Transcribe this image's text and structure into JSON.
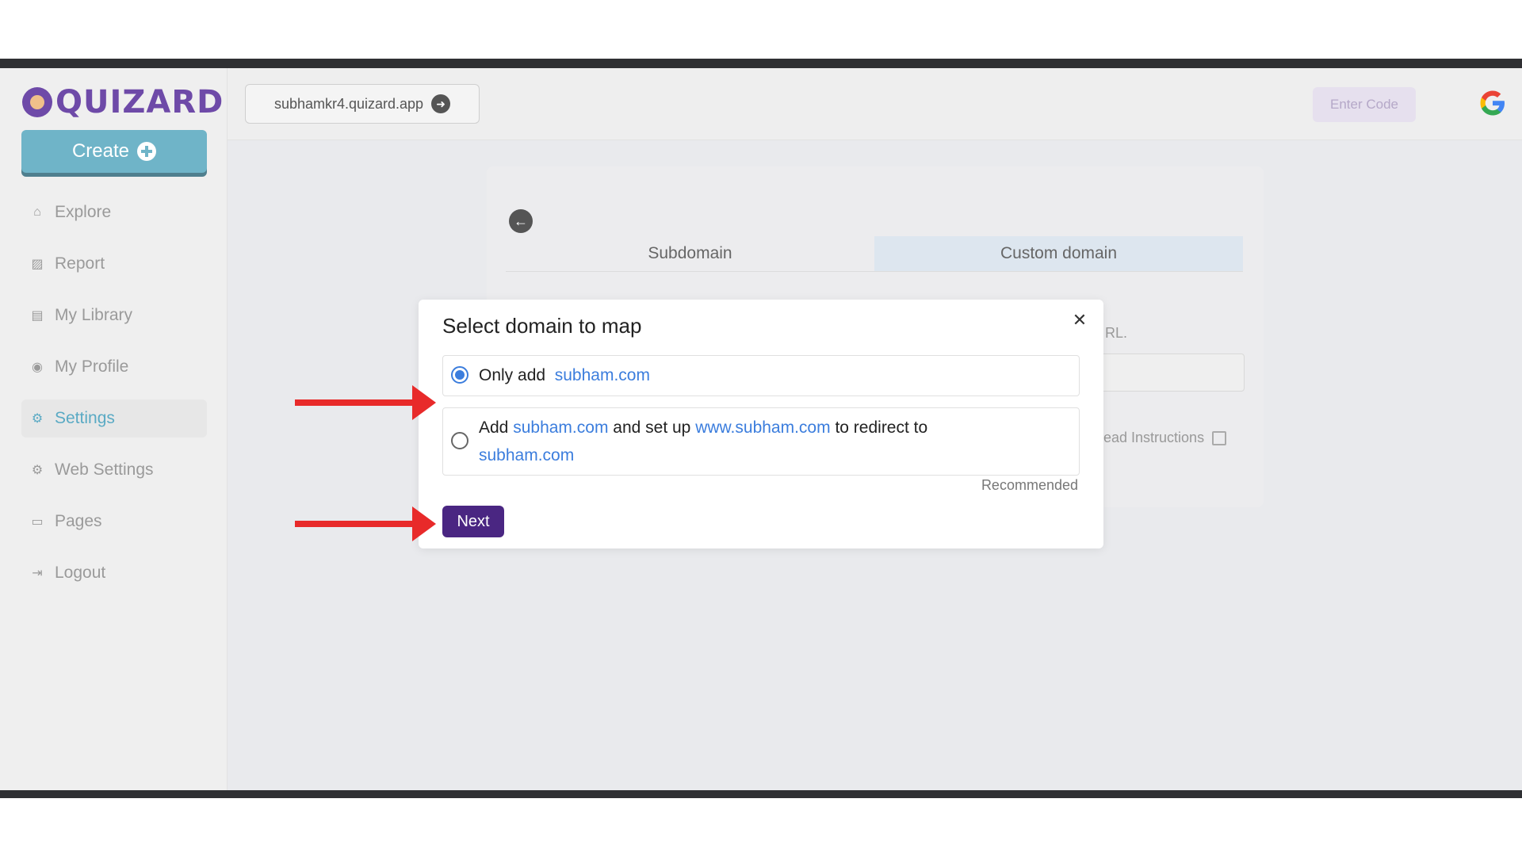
{
  "sidebar": {
    "logo": "QUIZARD",
    "create_label": "Create",
    "items": [
      {
        "label": "Explore",
        "icon": "home-icon"
      },
      {
        "label": "Report",
        "icon": "chart-icon"
      },
      {
        "label": "My Library",
        "icon": "library-icon"
      },
      {
        "label": "My Profile",
        "icon": "profile-icon"
      },
      {
        "label": "Settings",
        "icon": "gear-icon",
        "active": true
      },
      {
        "label": "Web Settings",
        "icon": "gear-icon"
      },
      {
        "label": "Pages",
        "icon": "pages-icon"
      },
      {
        "label": "Logout",
        "icon": "logout-icon"
      }
    ]
  },
  "header": {
    "url": "subhamkr4.quizard.app",
    "enter_code": "Enter Code"
  },
  "background": {
    "tabs": [
      "Subdomain",
      "Custom domain"
    ],
    "selected_tab": "Custom domain",
    "url_fragment": "RL.",
    "read_instructions": "ead Instructions"
  },
  "modal": {
    "title": "Select domain to map",
    "option1": {
      "prefix": "Only add",
      "domain": "subham.com",
      "selected": true
    },
    "option2": {
      "prefix": "Add",
      "domain": "subham.com",
      "middle": "and set up",
      "www_domain": "www.subham.com",
      "suffix": "to redirect to",
      "target": "subham.com",
      "selected": false
    },
    "recommended": "Recommended",
    "next_label": "Next"
  },
  "colors": {
    "accent_purple": "#4a2682",
    "link_blue": "#3b7ddd",
    "arrow_red": "#e82a2a",
    "create_teal": "#6fb4c8"
  }
}
